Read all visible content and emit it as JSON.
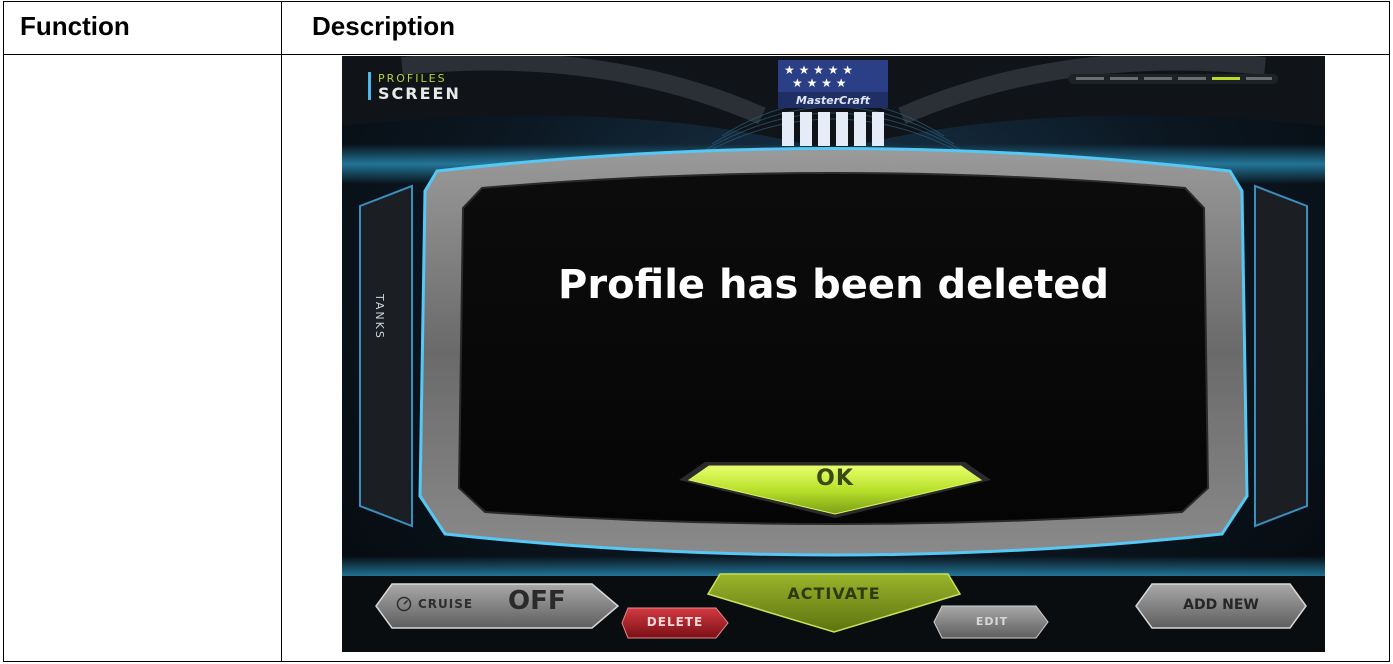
{
  "table": {
    "header_function": "Function",
    "header_description": "Description"
  },
  "screen": {
    "title_small": "PROFILES",
    "title_big": "SCREEN",
    "brand": "MasterCraft",
    "side_tab": "TANKS",
    "dialog": {
      "message": "Profile has been deleted",
      "ok_label": "OK"
    },
    "bottom": {
      "cruise_label": "CRUISE",
      "cruise_value": "OFF",
      "delete_label": "DELETE",
      "activate_label": "ACTIVATE",
      "edit_label": "EDIT",
      "add_new_label": "ADD NEW"
    },
    "icons": {
      "cruise": "speedometer-icon",
      "brand": "flag-logo-icon"
    },
    "colors": {
      "accent_green": "#b6dd2a",
      "accent_blue": "#33b5e8",
      "delete_red": "#b1202a"
    }
  }
}
